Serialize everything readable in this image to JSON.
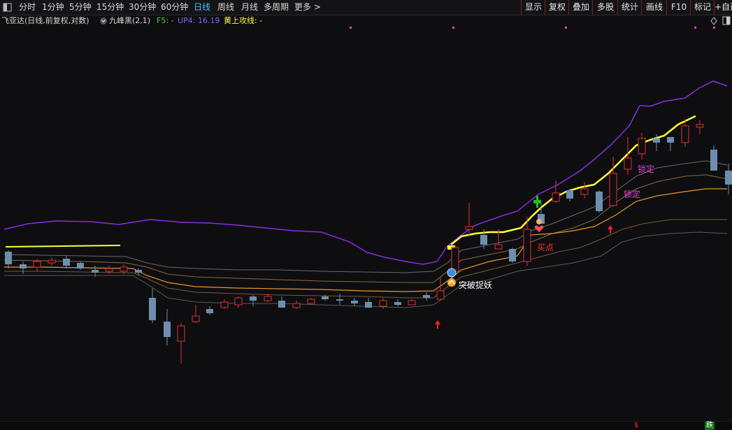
{
  "toolbar": {
    "periods": [
      {
        "label": "分时"
      },
      {
        "label": "1分钟"
      },
      {
        "label": "5分钟"
      },
      {
        "label": "15分钟"
      },
      {
        "label": "30分钟"
      },
      {
        "label": "60分钟"
      },
      {
        "label": "日线",
        "active": true
      },
      {
        "label": "周线"
      },
      {
        "label": "月线"
      },
      {
        "label": "多周期"
      },
      {
        "label": "更多 >"
      }
    ],
    "buttons": [
      {
        "label": "显示"
      },
      {
        "label": "复权"
      },
      {
        "label": "叠加"
      },
      {
        "label": "多股"
      },
      {
        "label": "统计"
      },
      {
        "label": "画线"
      },
      {
        "label": "F10"
      },
      {
        "label": "标记"
      },
      {
        "label": "+自选"
      }
    ]
  },
  "legend": {
    "title": "飞亚达(日线,前复权,对数)",
    "indicator": "九峰黑(2,1)",
    "f5": "F5: -",
    "up4": "UP4: 16.19",
    "huang": "黄上攻线: -"
  },
  "annotations": {
    "breakout": "突破捉妖",
    "lock1": "锁定",
    "lock2": "锁定",
    "buy": "买点"
  },
  "bottom": {
    "dollar": "$",
    "fall": "跌"
  },
  "colors": {
    "up": "#e0302f",
    "down": "#6e8eae",
    "purple": "#8a2be2",
    "yellow": "#ffff3a",
    "orange": "#e8962e",
    "magenta": "#e040e0"
  }
}
